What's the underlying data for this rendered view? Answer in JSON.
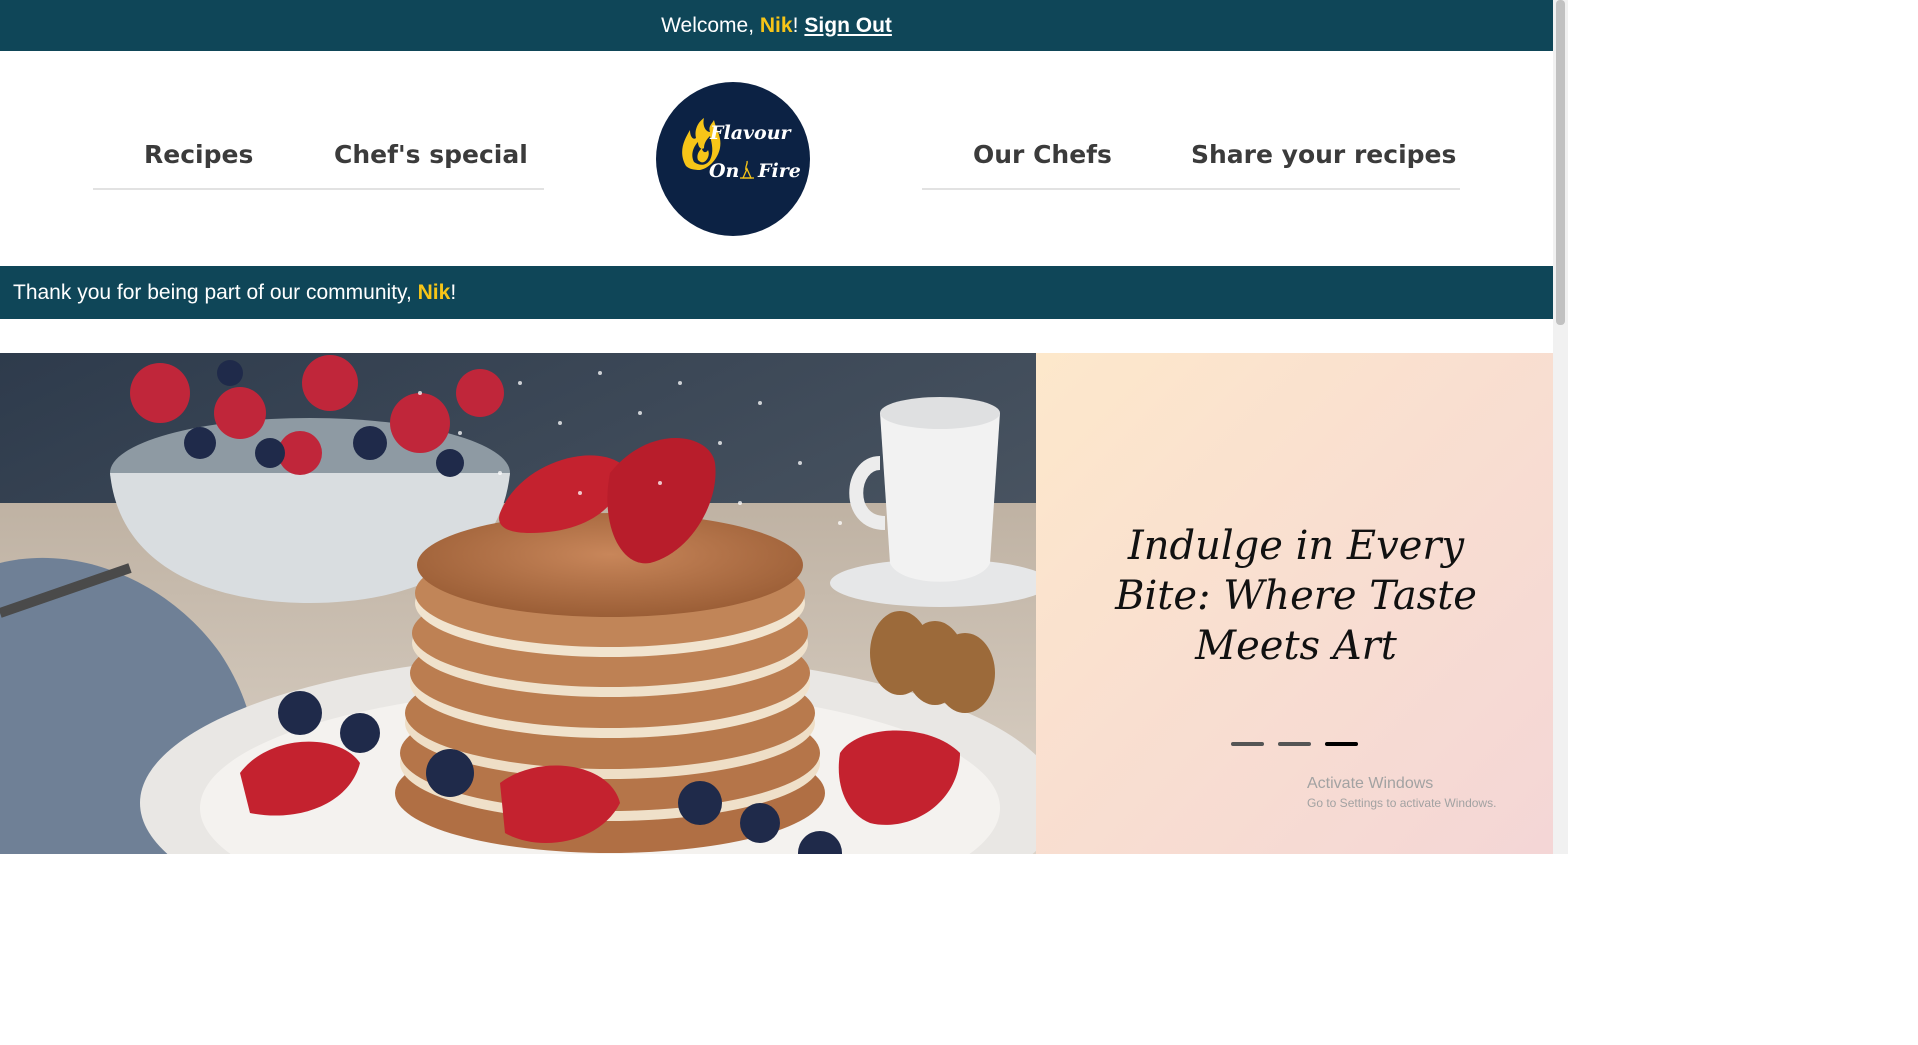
{
  "topbar": {
    "welcome_prefix": "Welcome, ",
    "user_name": "Nik",
    "welcome_suffix": "!",
    "sign_out": "Sign Out"
  },
  "nav": {
    "left": [
      "Recipes",
      "Chef's special"
    ],
    "right": [
      "Our Chefs",
      "Share your recipes"
    ]
  },
  "logo": {
    "line1": "Flavour",
    "line2_a": "On",
    "line2_b": "Fire",
    "icon": "flame-icon"
  },
  "community": {
    "prefix": "Thank you for being part of our community, ",
    "user_name": "Nik",
    "suffix": "!"
  },
  "hero": {
    "image_desc": "pancake-stack-photo",
    "tagline_lines": [
      "Indulge in Every",
      "Bite: Where Taste",
      "Meets Art"
    ],
    "slides_total": 3,
    "active_slide": 3
  },
  "watermark": {
    "title": "Activate Windows",
    "subtitle": "Go to Settings to activate Windows."
  },
  "colors": {
    "banner_bg": "#0f4658",
    "accent_yellow": "#f7c518",
    "logo_bg": "#0c2244",
    "nav_text": "#3b3b3b"
  }
}
